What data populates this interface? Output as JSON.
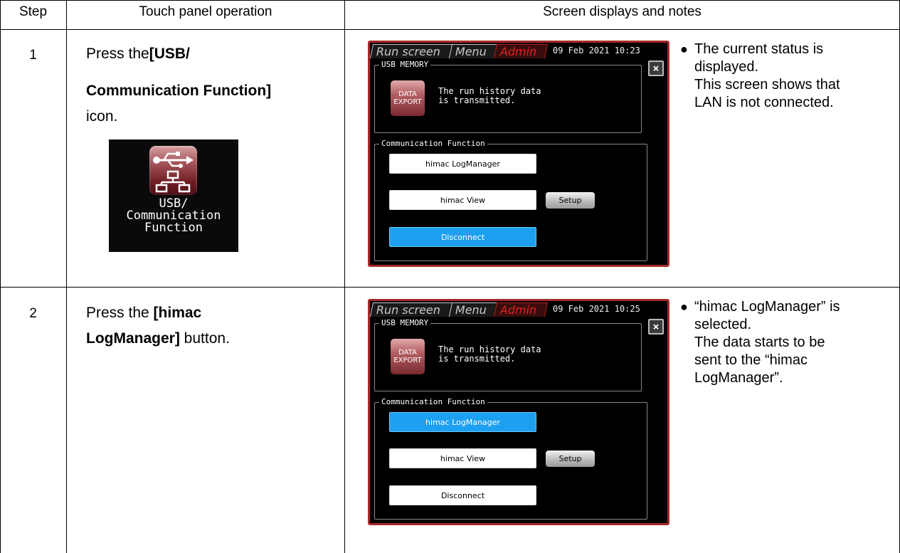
{
  "table": {
    "headers": {
      "step": "Step",
      "operation": "Touch panel operation",
      "screen": "Screen displays and notes"
    },
    "rows": [
      {
        "step": "1",
        "op_line1_pre": "Press the",
        "op_line1_bold": "[USB/",
        "op_line2_bold": "Communication Function]",
        "op_line3": "icon.",
        "icon": {
          "name": "usb-communication-function-icon",
          "caption_line1": "USB/",
          "caption_line2": "Communication",
          "caption_line3": "Function"
        },
        "screen": {
          "tab_run": "Run screen",
          "tab_menu": "Menu",
          "tab_admin": "Admin",
          "datetime": "09 Feb 2021 10:23",
          "close": "×",
          "usb_group_title": "USB MEMORY",
          "export_line1": "DATA",
          "export_line2": "EXPORT",
          "usb_msg_line1": "The run history data",
          "usb_msg_line2": "is transmitted.",
          "comm_group_title": "Communication Function",
          "btn_logmanager": "himac LogManager",
          "btn_view": "himac View",
          "btn_setup": "Setup",
          "btn_disconnect": "Disconnect",
          "selected": "disconnect"
        },
        "notes": {
          "bullet": "●",
          "line1": "The current status is",
          "line2": "displayed.",
          "line3": "This screen shows that",
          "line4": "LAN is not connected."
        }
      },
      {
        "step": "2",
        "op_line1_pre": "Press the ",
        "op_line1_bold": "[himac",
        "op_line2_bold": "LogManager]",
        "op_line2_post": " button.",
        "screen": {
          "tab_run": "Run screen",
          "tab_menu": "Menu",
          "tab_admin": "Admin",
          "datetime": "09 Feb 2021 10:25",
          "close": "×",
          "usb_group_title": "USB MEMORY",
          "export_line1": "DATA",
          "export_line2": "EXPORT",
          "usb_msg_line1": "The run history data",
          "usb_msg_line2": "is transmitted.",
          "comm_group_title": "Communication Function",
          "btn_logmanager": "himac LogManager",
          "btn_view": "himac View",
          "btn_setup": "Setup",
          "btn_disconnect": "Disconnect",
          "selected": "logmanager"
        },
        "notes": {
          "bullet": "●",
          "line1": "“himac LogManager” is",
          "line2": "selected.",
          "line3": "The data starts to be",
          "line4": "sent to the “himac",
          "line5": "LogManager”."
        }
      }
    ]
  },
  "colors": {
    "selected_button": "#1ea0f0",
    "admin_tab": "#e02020",
    "screen_border": "#a52a2a"
  }
}
